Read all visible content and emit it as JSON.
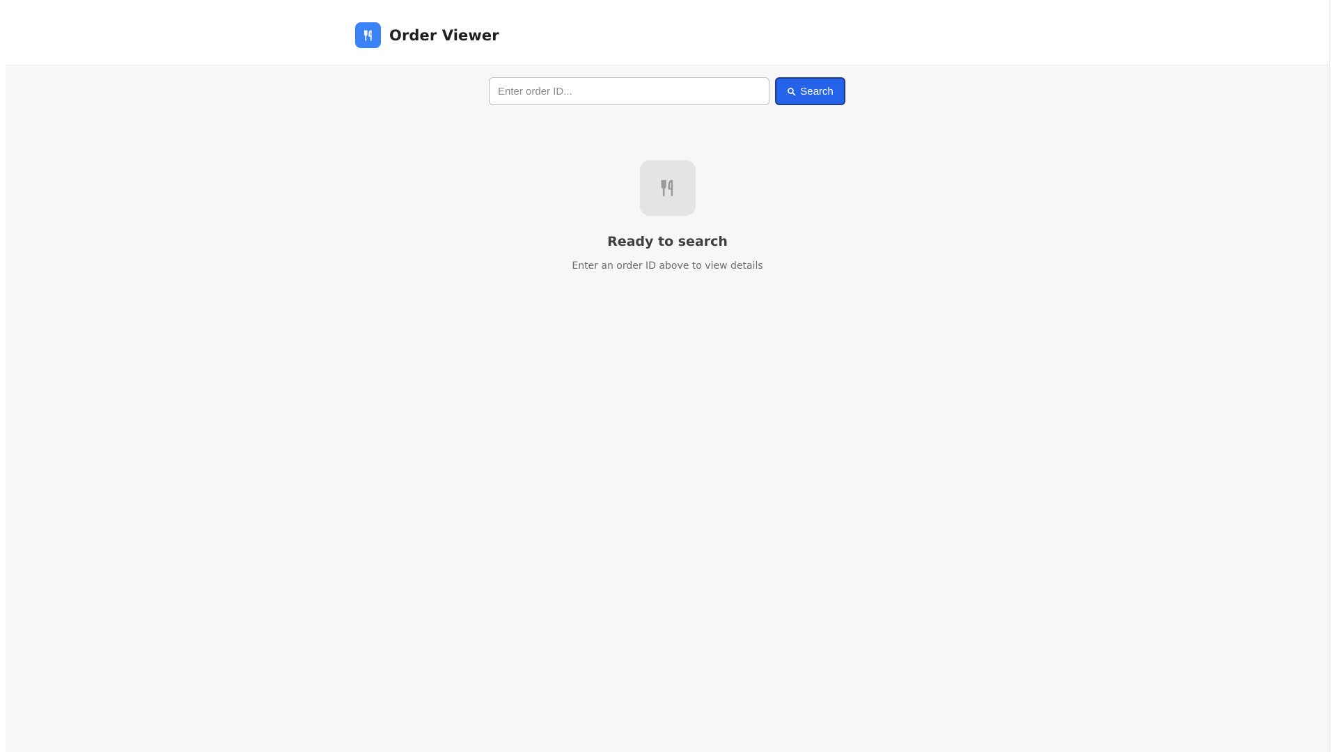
{
  "app": {
    "title": "Order Viewer",
    "logo_icon": "utensils-icon",
    "accent_color": "#3b82f6"
  },
  "search": {
    "placeholder": "Enter order ID...",
    "value": "",
    "button_label": "Search",
    "button_icon": "search-icon",
    "button_color": "#2563eb"
  },
  "empty_state": {
    "icon": "utensils-icon",
    "title": "Ready to search",
    "subtitle": "Enter an order ID above to view details"
  }
}
